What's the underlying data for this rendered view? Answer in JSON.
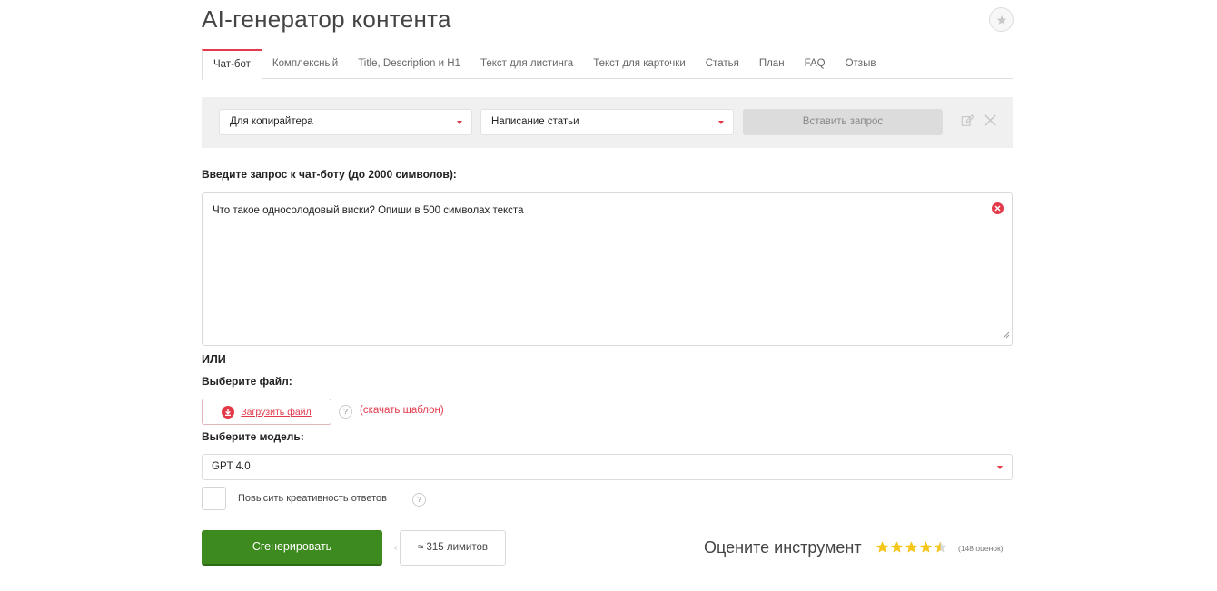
{
  "header": {
    "title": "AI-генератор контента",
    "favorite_icon": "star-icon"
  },
  "tabs": [
    {
      "label": "Чат-бот",
      "active": true
    },
    {
      "label": "Комплексный",
      "active": false
    },
    {
      "label": "Title, Description и H1",
      "active": false
    },
    {
      "label": "Текст для листинга",
      "active": false
    },
    {
      "label": "Текст для карточки",
      "active": false
    },
    {
      "label": "Статья",
      "active": false
    },
    {
      "label": "План",
      "active": false
    },
    {
      "label": "FAQ",
      "active": false
    },
    {
      "label": "Отзыв",
      "active": false
    }
  ],
  "preset_bar": {
    "role_select": "Для копирайтера",
    "task_select": "Написание статьи",
    "insert_button": "Вставить запрос",
    "edit_icon": "edit-icon",
    "close_icon": "close-icon"
  },
  "prompt": {
    "label": "Введите запрос к чат-боту (до 2000 символов):",
    "value": "Что такое односолодовый виски? Опиши в 500 символах текста"
  },
  "or_text": "ИЛИ",
  "file": {
    "label": "Выберите файл:",
    "upload_button": "Загрузить файл",
    "help": "?",
    "template_link": "(скачать шаблон)"
  },
  "model": {
    "label": "Выберите модель:",
    "selected": "GPT 4.0"
  },
  "creativity": {
    "label": "Повысить креативность ответов",
    "checked": false,
    "help": "?"
  },
  "actions": {
    "generate_button": "Сгенерировать",
    "limits": "≈ 315 лимитов"
  },
  "rating": {
    "label": "Оцените инструмент",
    "stars_value": 4.5,
    "stars_max": 5,
    "count": "(148 оценок)"
  },
  "colors": {
    "accent_red": "#e23a4b",
    "generate_green": "#3d8a1f",
    "star_gold": "#f5c518"
  }
}
